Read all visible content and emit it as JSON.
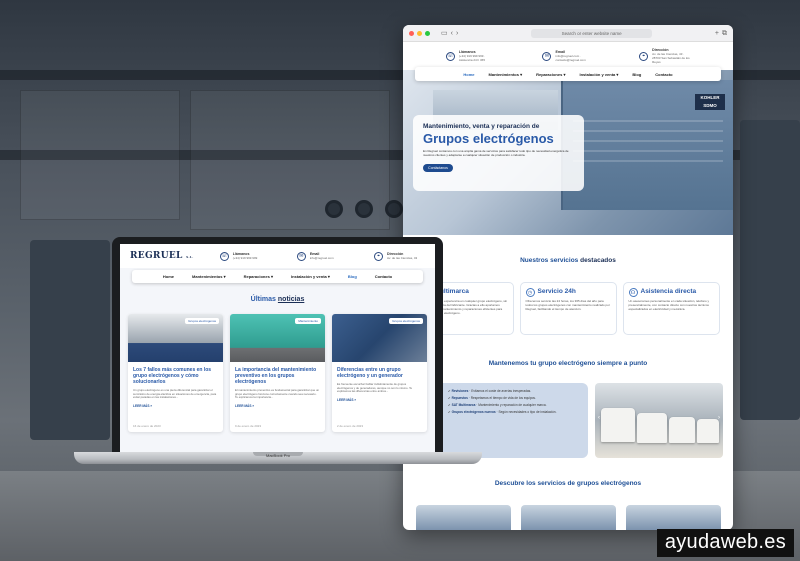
{
  "browser": {
    "url_placeholder": "Search or enter website name",
    "contact": [
      {
        "icon": "phone-icon",
        "title": "Llámanos",
        "sub": "(+34) 919 999 999 · Asistencia 24 h 365"
      },
      {
        "icon": "mail-icon",
        "title": "Email",
        "sub": "info@regruel.com · contacto@regruel.com"
      },
      {
        "icon": "location-icon",
        "title": "Dirección",
        "sub": "Av. de las Ciencias, 43 · 28703 San Sebastián de los Reyes"
      }
    ],
    "nav": [
      "Home",
      "Mantenimientos ▾",
      "Reparaciones ▾",
      "Instalación y venta ▾",
      "Blog",
      "Contacto"
    ],
    "hero": {
      "kicker": "Mantenimiento, venta y reparación de",
      "headline": "Grupos electrógenos",
      "paragraph": "En Regruel contamos con una amplia gama de servicios para satisfacer todo tipo de necesidad energética de nuestros clientes y adaptarse a cualquier situación de producción o industria.",
      "button": "Contáctanos",
      "brand": "KOHLER SDMO"
    },
    "services_title_plain": "Nuestros servicios",
    "services_title_bold": "destacados",
    "services": [
      {
        "title": "Multimarca",
        "text": "Disponemos de experiencia en cualquier grupo electrógeno, sin importar la marca del fabricante. Gracias a ello aportamos soluciones de mantenimiento y reparaciones eficientes para cualquier grupo electrógeno."
      },
      {
        "title": "Servicio 24h",
        "text": "Ofrecemos servicio las 24 horas, los 365 días del año para todos los grupos electrógenos con mantenimiento realizado por Regruel, facilitando el tiempo de atención."
      },
      {
        "title": "Asistencia directa",
        "text": "Un asesorames personalmente en cada situación, teléfono y presencialmente, con contacto directo con nuestros técnicos especializados en electricidad y mecánica."
      }
    ],
    "maintain_title": "Mantenemos tu grupo electrógeno siempre a punto",
    "maintain_items": [
      {
        "bold": "Revisiones",
        "text": "Evitamos el coste de averías inesperadas."
      },
      {
        "bold": "Repuestos",
        "text": "Respetamos el tiempo de vida de los equipos."
      },
      {
        "bold": "SAT Multimarca",
        "text": "Mantenimiento y reparación de cualquier marca."
      },
      {
        "bold": "Grupos electrógenos nuevos",
        "text": "Según necesidades o tipo de instalación."
      }
    ],
    "discover_title": "Descubre los servicios de grupos electrógenos"
  },
  "laptop": {
    "logo": "REGRUEL",
    "logo_suffix": "S.L.",
    "contact": [
      {
        "icon": "phone-icon",
        "title": "Llámanos",
        "sub": "(+34) 919 999 999"
      },
      {
        "icon": "mail-icon",
        "title": "Email",
        "sub": "info@regruel.com"
      },
      {
        "icon": "location-icon",
        "title": "Dirección",
        "sub": "Av. de las Ciencias, 43"
      }
    ],
    "nav": [
      "Home",
      "Mantenimientos ▾",
      "Reparaciones ▾",
      "Instalación y venta ▾",
      "Blog",
      "Contacto"
    ],
    "news_title_plain": "Últimas",
    "news_title_bold": "noticias",
    "posts": [
      {
        "tag": "Grupos electrógenos",
        "title": "Los 7 fallos más comunes en los grupo electrógenos y cómo solucionarlos",
        "excerpt": "Un grupo electrógeno es una pieza diferencial para garantizar el suministro de energía eléctrica en situaciones de emergencia, para evitar paradas en las instalaciones...",
        "more": "LEER MÁS »",
        "date": "16 de enero de 2023"
      },
      {
        "tag": "Mantenimiento",
        "title": "La importancia del mantenimiento preventivo en los grupos electrógenos",
        "excerpt": "El mantenimiento preventivo es fundamental para garantizar que un grupo electrógeno funcione correctamente cuando sea necesario. Te explicamos la importancia...",
        "more": "LEER MÁS »",
        "date": "9 de enero de 2023"
      },
      {
        "tag": "Grupos electrógenos",
        "title": "Diferencias entre un grupo electrógeno y un generador",
        "excerpt": "Es frecuente escuchar hablar indistintamente de grupos electrógenos y de generadores, aunque no son lo mismo. Te explicamos las diferencias entre ambos...",
        "more": "LEER MÁS »",
        "date": "2 de enero de 2023"
      }
    ],
    "base_label": "MacBook Pro"
  },
  "watermark": "ayudaweb.es",
  "colors": {
    "brand_blue": "#2a5aa8",
    "brand_dark": "#1a2e55"
  }
}
